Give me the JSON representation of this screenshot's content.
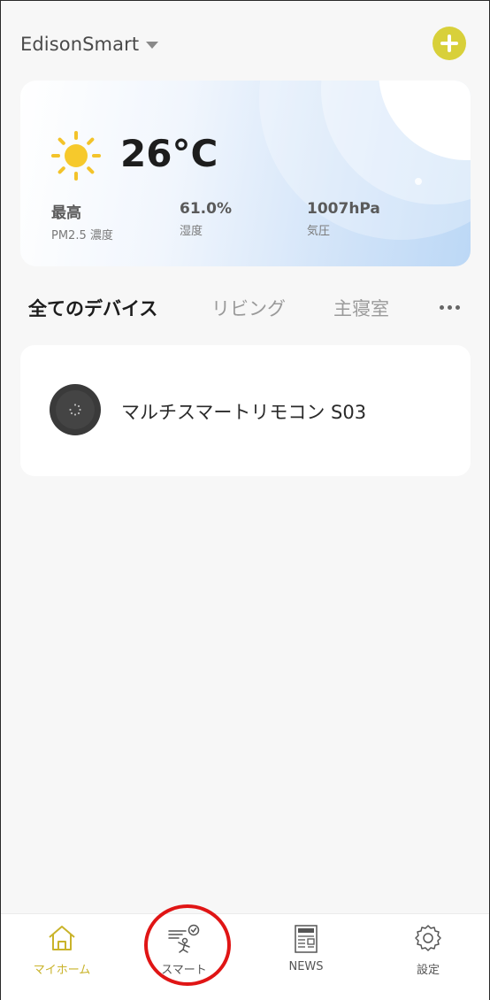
{
  "header": {
    "home_name": "EdisonSmart",
    "add_button_color": "#d8d03a",
    "add_icon": "plus-icon"
  },
  "weather": {
    "icon": "sun-icon",
    "temperature": "26°C",
    "stats": [
      {
        "value": "最高",
        "label": "PM2.5 濃度"
      },
      {
        "value": "61.0%",
        "label": "湿度"
      },
      {
        "value": "1007hPa",
        "label": "気圧"
      }
    ]
  },
  "tabs": [
    {
      "label": "全てのデバイス",
      "active": true
    },
    {
      "label": "リビング",
      "active": false
    },
    {
      "label": "主寝室",
      "active": false
    }
  ],
  "more_icon": "more-dots-icon",
  "devices": [
    {
      "name": "マルチスマートリモコン S03",
      "icon": "remote-hub-icon"
    }
  ],
  "bottom_nav": [
    {
      "label": "マイホーム",
      "icon": "home-icon",
      "active": true
    },
    {
      "label": "スマート",
      "icon": "smart-scene-icon",
      "active": false
    },
    {
      "label": "NEWS",
      "icon": "news-icon",
      "active": false
    },
    {
      "label": "設定",
      "icon": "settings-gear-icon",
      "active": false
    }
  ],
  "colors": {
    "accent": "#c9b32a",
    "highlight_ring": "#e01515",
    "background": "#f7f7f7"
  }
}
